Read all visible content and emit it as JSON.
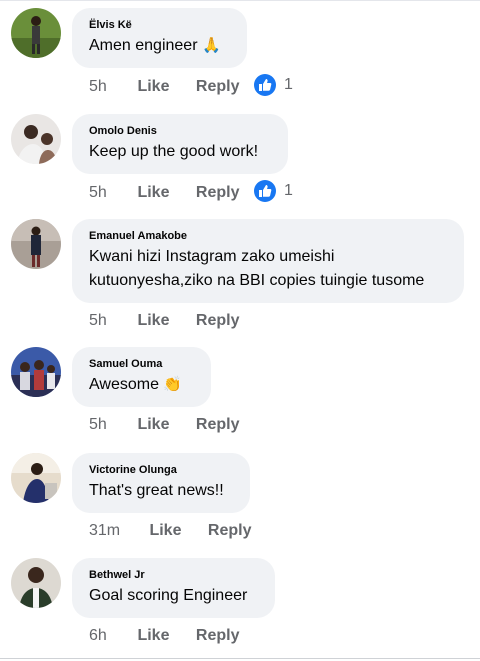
{
  "comments": [
    {
      "author": "Ëlvis Kë",
      "text": "Amen engineer",
      "emoji": "🙏",
      "time": "5h",
      "like_label": "Like",
      "reply_label": "Reply",
      "reaction_count": "1"
    },
    {
      "author": "Omolo Denis",
      "text": "Keep up the good work!",
      "emoji": "",
      "time": "5h",
      "like_label": "Like",
      "reply_label": "Reply",
      "reaction_count": "1"
    },
    {
      "author": "Emanuel Amakobe",
      "text_line1": "Kwani hizi Instagram zako umeishi",
      "text_line2": "kutuonyesha,ziko na BBI copies tuingie tusome",
      "time": "5h",
      "like_label": "Like",
      "reply_label": "Reply"
    },
    {
      "author": "Samuel Ouma",
      "text": "Awesome",
      "emoji": "👏",
      "time": "5h",
      "like_label": "Like",
      "reply_label": "Reply"
    },
    {
      "author": "Victorine Olunga",
      "text": "That's great news!!",
      "time": "31m",
      "like_label": "Like",
      "reply_label": "Reply"
    },
    {
      "author": "Bethwel Jr",
      "text": "Goal scoring Engineer",
      "time": "6h",
      "like_label": "Like",
      "reply_label": "Reply"
    }
  ],
  "icons": {
    "reaction": "like-thumb-icon",
    "reaction_color": "#1877f2"
  },
  "colors": {
    "bubble_bg": "#f0f2f5",
    "meta_text": "#65676b",
    "text": "#050505"
  }
}
